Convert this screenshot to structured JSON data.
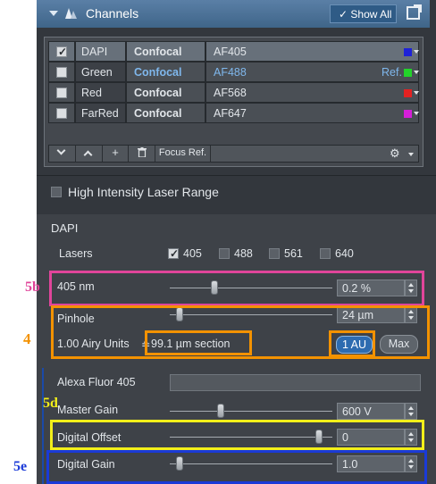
{
  "header": {
    "title": "Channels",
    "show_all_label": "✓ Show All"
  },
  "channels": [
    {
      "checked": true,
      "name": "DAPI",
      "mode": "Confocal",
      "dye": "AF405",
      "ref": "",
      "color": "#1e22d8"
    },
    {
      "checked": false,
      "name": "Green",
      "mode": "Confocal",
      "dye": "AF488",
      "ref": "Ref.",
      "color": "#22d32a"
    },
    {
      "checked": false,
      "name": "Red",
      "mode": "Confocal",
      "dye": "AF568",
      "ref": "",
      "color": "#e42222"
    },
    {
      "checked": false,
      "name": "FarRed",
      "mode": "Confocal",
      "dye": "AF647",
      "ref": "",
      "color": "#d51fd8"
    }
  ],
  "toolbar": {
    "add_label": "+",
    "focus_ref_label": "Focus Ref."
  },
  "high_intensity": {
    "label": "High Intensity Laser Range",
    "checked": false
  },
  "dapi_section": {
    "title": "DAPI",
    "lasers_label": "Lasers",
    "lasers": [
      {
        "label": "405",
        "checked": true
      },
      {
        "label": "488",
        "checked": false
      },
      {
        "label": "561",
        "checked": false
      },
      {
        "label": "640",
        "checked": false
      }
    ],
    "laser_power": {
      "label": "405 nm",
      "value": "0.2 %",
      "level": 0.2
    },
    "pinhole": {
      "label": "Pinhole",
      "value": "24 µm",
      "level": 0.05,
      "airy_units": "1.00 Airy Units",
      "separator": "≙",
      "section": "99.1 µm section",
      "btn_1au": "1 AU",
      "btn_max": "Max"
    },
    "dye_label": "Alexa Fluor 405",
    "master_gain": {
      "label": "Master Gain",
      "value": "600 V",
      "level": 0.3
    },
    "digital_offset": {
      "label": "Digital Offset",
      "value": "0",
      "level": 0.95
    },
    "digital_gain": {
      "label": "Digital Gain",
      "value": "1.0",
      "level": 0.05
    }
  },
  "annotations": {
    "label_4": "4",
    "label_5b": "5b",
    "label_5d": "5d",
    "label_5e": "5e"
  },
  "annotation_colors": {
    "pink": "#e0459a",
    "orange": "#f39200",
    "yellow": "#f2ef1a",
    "blue": "#1a3ad8"
  }
}
